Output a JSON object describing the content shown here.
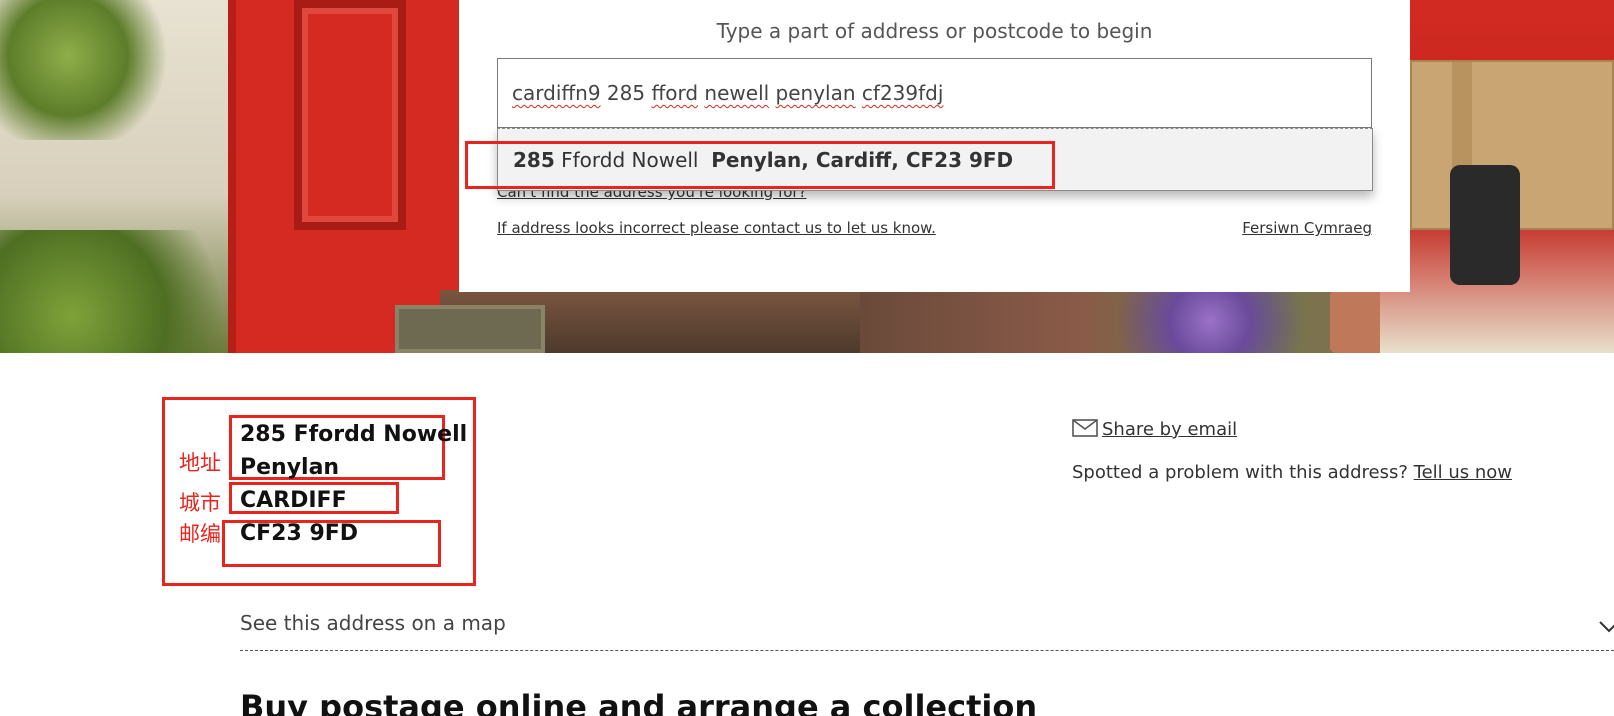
{
  "search": {
    "prompt": "Type a part of address or postcode to begin",
    "value_prefix": "cardiffn9",
    "value_number": "285",
    "value_words": [
      "fford",
      "newell",
      "penylan",
      "cf239fdj"
    ],
    "value": "cardiffn9 285 fford newell penylan cf239fdj",
    "suggestion": {
      "number": "285",
      "street": "Ffordd Nowell",
      "rest": "Penylan, Cardiff, CF23 9FD"
    },
    "cant_find_link": "Can't find the address you're looking for?",
    "incorrect_link": "If address looks incorrect please contact us to let us know.",
    "welsh_link": "Fersiwn Cymraeg"
  },
  "result": {
    "address_line1": "285 Ffordd Nowell",
    "address_line2": "Penylan",
    "city": "CARDIFF",
    "postcode": "CF23 9FD",
    "annotations": {
      "address": "地址",
      "city": "城市",
      "postcode": "邮编"
    },
    "share_label": "Share by email",
    "problem_text": "Spotted a problem with this address?",
    "problem_link": "Tell us now",
    "map_label": "See this address on a map"
  },
  "section": {
    "heading": "Buy postage online and arrange a collection"
  },
  "icons": {
    "share": "mail-icon",
    "map_toggle": "chevron-down-icon"
  },
  "colors": {
    "annotation_red": "#e8241d",
    "hero_red": "#d42a22"
  }
}
